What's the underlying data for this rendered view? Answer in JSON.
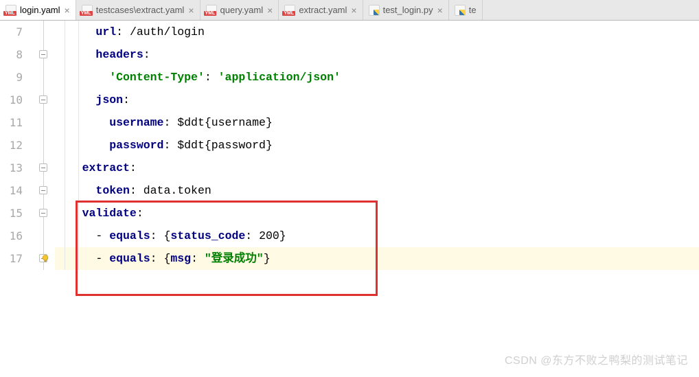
{
  "tabs": [
    {
      "label": "login.yaml",
      "type": "yaml",
      "active": true
    },
    {
      "label": "testcases\\extract.yaml",
      "type": "yaml",
      "active": false
    },
    {
      "label": "query.yaml",
      "type": "yaml",
      "active": false
    },
    {
      "label": "extract.yaml",
      "type": "yaml",
      "active": false
    },
    {
      "label": "test_login.py",
      "type": "py",
      "active": false
    },
    {
      "label": "te",
      "type": "py",
      "active": false
    }
  ],
  "lines": {
    "start": 7,
    "rows": [
      {
        "n": "7",
        "html": "      <span class='k-key'>url</span>: /auth/login"
      },
      {
        "n": "8",
        "html": "      <span class='k-key'>headers</span>:"
      },
      {
        "n": "9",
        "html": "        <span class='k-str'>'Content-Type'</span>: <span class='k-str'>'application/json'</span>"
      },
      {
        "n": "10",
        "html": "      <span class='k-key'>json</span>:"
      },
      {
        "n": "11",
        "html": "        <span class='k-key'>username</span>: $ddt{username}"
      },
      {
        "n": "12",
        "html": "        <span class='k-key'>password</span>: $ddt{password}"
      },
      {
        "n": "13",
        "html": "    <span class='k-key'>extract</span>:"
      },
      {
        "n": "14",
        "html": "      <span class='k-key'>token</span>: data.token"
      },
      {
        "n": "15",
        "html": "    <span class='k-key'>validate</span>:"
      },
      {
        "n": "16",
        "html": "      - <span class='k-key'>equals</span>: {<span class='k-key'>status_code</span>: 200}"
      },
      {
        "n": "17",
        "html": "      - <span class='k-key'>equals</span>: {<span class='k-key'>msg</span>: <span class='k-str'>\"登录成功\"</span>}",
        "hl": true
      }
    ]
  },
  "redbox": {
    "top_line": 15,
    "bot_line": 17
  },
  "watermark": "CSDN @东方不败之鸭梨的测试笔记"
}
